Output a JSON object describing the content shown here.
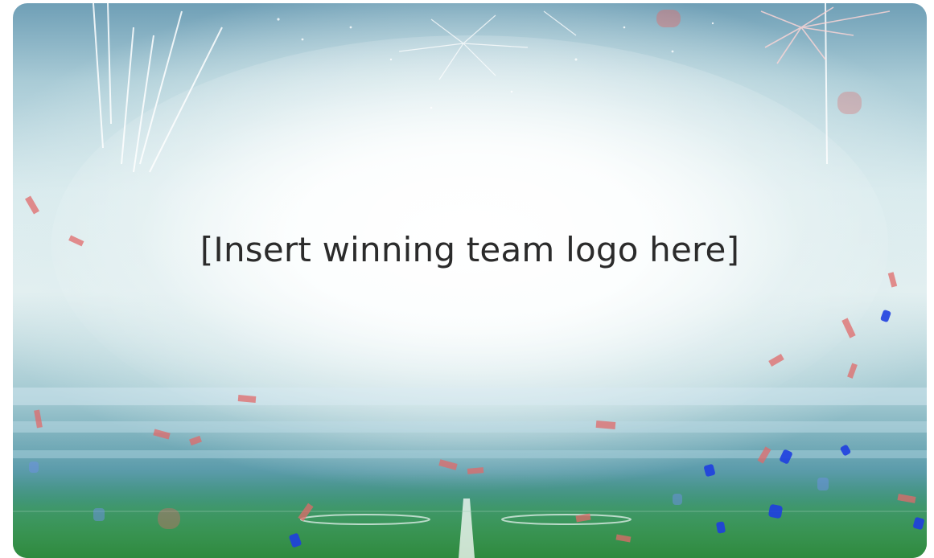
{
  "placeholder": {
    "text": "[Insert winning team logo here]"
  },
  "colors": {
    "sky_top": "#6f9fb6",
    "haze": "#e4f0f1",
    "field": "#3b8f48",
    "confetti_blue": "#1f3fe0",
    "confetti_red": "#e06a6a",
    "text": "#2b2b2b"
  },
  "decorations": {
    "background": "stadium-field-scene",
    "fireworks": "firework-bursts",
    "confetti": "red-and-blue-confetti"
  }
}
